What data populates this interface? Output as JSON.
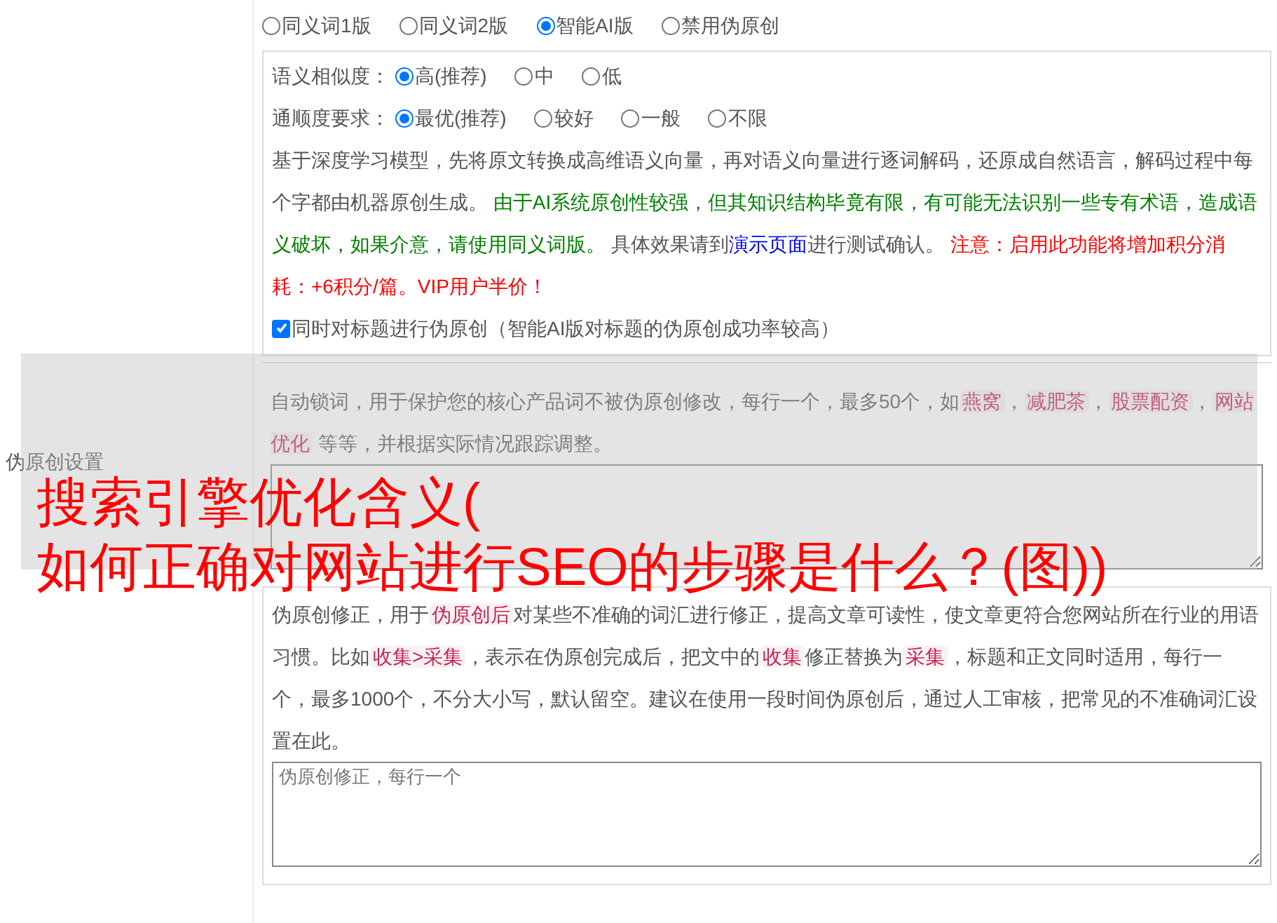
{
  "section_label": "伪原创设置",
  "mode_options": [
    {
      "label": "同义词1版",
      "selected": false
    },
    {
      "label": "同义词2版",
      "selected": false
    },
    {
      "label": "智能AI版",
      "selected": true
    },
    {
      "label": "禁用伪原创",
      "selected": false
    }
  ],
  "ai_panel": {
    "settings": [
      {
        "label": "语义相似度：",
        "options": [
          {
            "label": "高(推荐)",
            "selected": true
          },
          {
            "label": "中",
            "selected": false
          },
          {
            "label": "低",
            "selected": false
          }
        ]
      },
      {
        "label": "通顺度要求：",
        "options": [
          {
            "label": "最优(推荐)",
            "selected": true
          },
          {
            "label": "较好",
            "selected": false
          },
          {
            "label": "一般",
            "selected": false
          },
          {
            "label": "不限",
            "selected": false
          }
        ]
      }
    ],
    "description": [
      {
        "kind": "text",
        "text": "基于深度学习模型，先将原文转换成高维语义向量，再对语义向量进行逐词解码，还原成自然语言，解码过程中每个字都由机器原创生成。 "
      },
      {
        "kind": "green",
        "text": "由于AI系统原创性较强，但其知识结构毕竟有限，有可能无法识别一些专有术语，造成语义破坏，如果介意，请使用同义词版。"
      },
      {
        "kind": "text",
        "text": " 具体效果请到"
      },
      {
        "kind": "link",
        "text": "演示页面"
      },
      {
        "kind": "text",
        "text": "进行测试确认。 "
      },
      {
        "kind": "red",
        "text": "注意：启用此功能将增加积分消耗：+6积分/篇。VIP用户半价！"
      }
    ],
    "title_option": {
      "label": "同时对标题进行伪原创（智能AI版对标题的伪原创成功率较高）",
      "checked": true
    }
  },
  "lock_words": {
    "description": [
      {
        "kind": "text",
        "text": "自动锁词，用于保护您的核心产品词不被伪原创修改，每行一个，最多50个，如"
      },
      {
        "kind": "tag",
        "text": "燕窝"
      },
      {
        "kind": "text",
        "text": "，"
      },
      {
        "kind": "tag",
        "text": "减肥茶"
      },
      {
        "kind": "text",
        "text": "，"
      },
      {
        "kind": "tag",
        "text": "股票配资"
      },
      {
        "kind": "text",
        "text": "，"
      },
      {
        "kind": "tag",
        "text": "网站优化"
      },
      {
        "kind": "text",
        "text": " 等等，并根据实际情况跟踪调整。"
      }
    ]
  },
  "corrections": {
    "description": [
      {
        "kind": "text",
        "text": "伪原创修正，用于"
      },
      {
        "kind": "tag",
        "text": "伪原创后"
      },
      {
        "kind": "text",
        "text": "对某些不准确的词汇进行修正，提高文章可读性，使文章更符合您网站所在行业的用语习惯。比如"
      },
      {
        "kind": "tag",
        "text": "收集>采集"
      },
      {
        "kind": "text",
        "text": "，表示在伪原创完成后，把文中的"
      },
      {
        "kind": "tag",
        "text": "收集"
      },
      {
        "kind": "text",
        "text": "修正替换为"
      },
      {
        "kind": "tag",
        "text": "采集"
      },
      {
        "kind": "text",
        "text": "，标题和正文同时适用，每行一个，最多1000个，不分大小写，默认留空。建议在使用一段时间伪原创后，通过人工审核，把常见的不准确词汇设置在此。"
      }
    ],
    "placeholder": "伪原创修正，每行一个"
  },
  "overlay_title": [
    "搜索引擎优化含义(",
    "如何正确对网站进行SEO的步骤是什么？(图))"
  ]
}
